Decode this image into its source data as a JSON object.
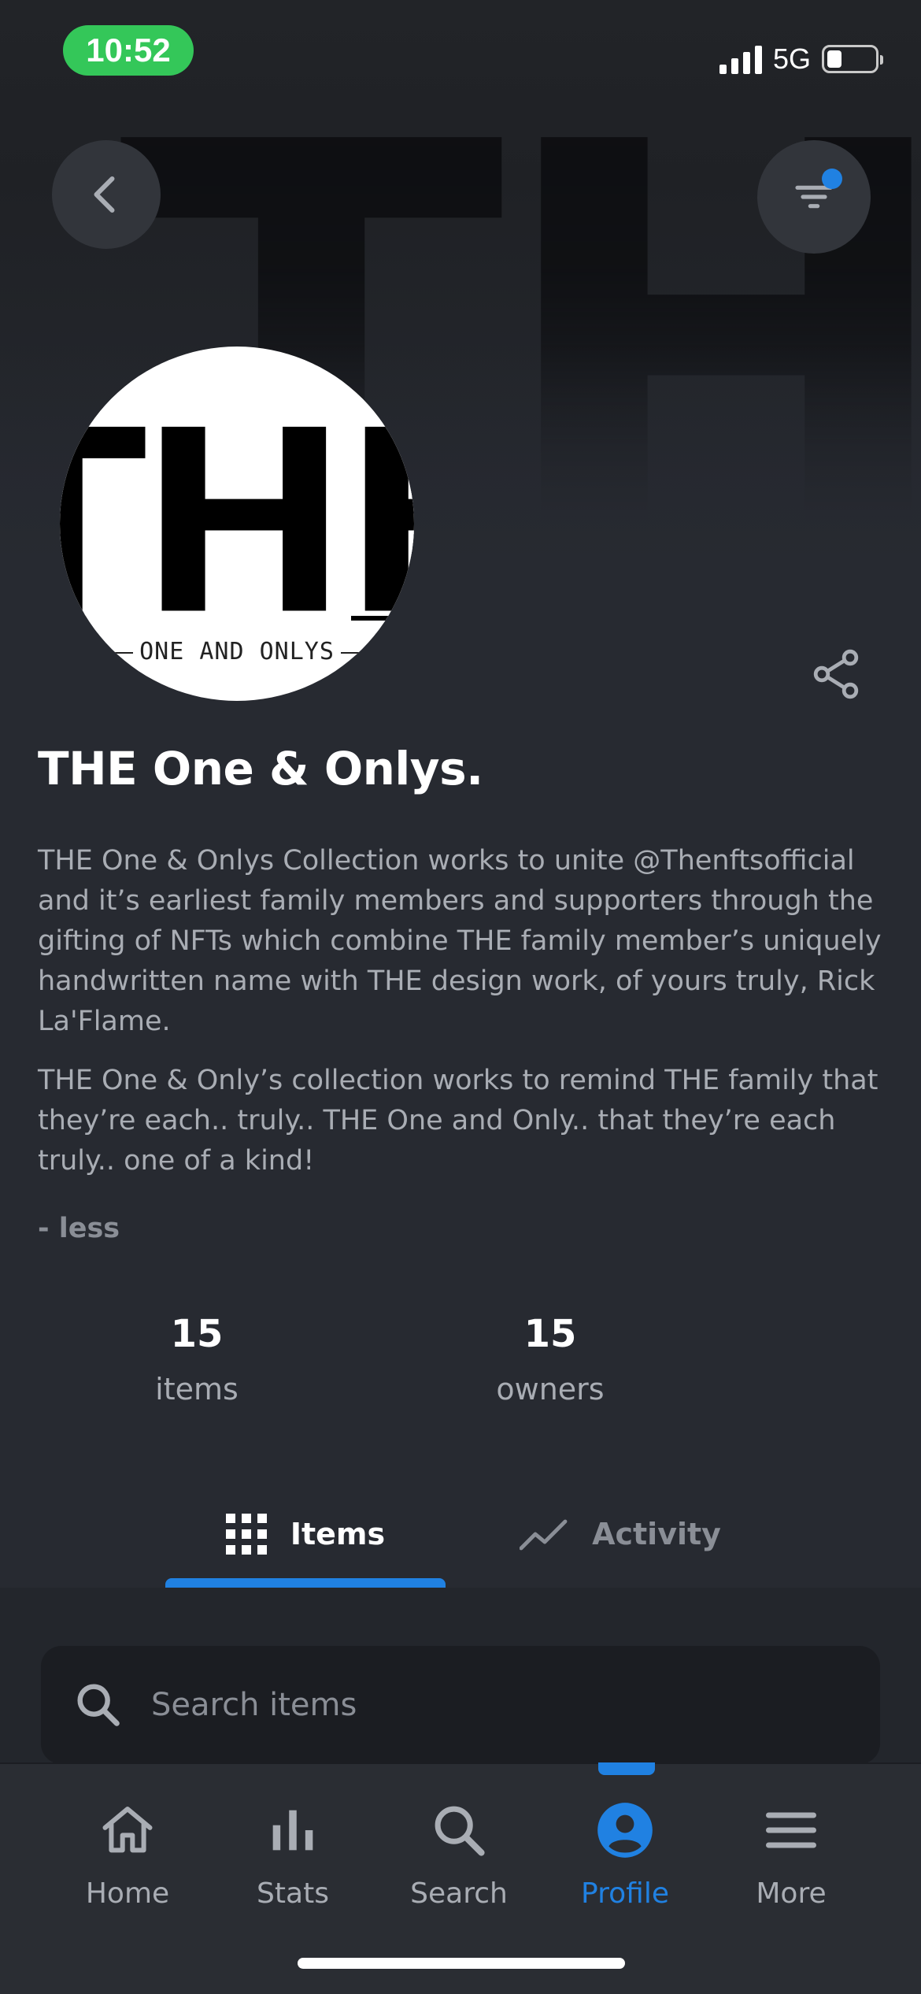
{
  "status_bar": {
    "time": "10:52",
    "network": "5G",
    "battery_level": 0.25
  },
  "header": {
    "banner_text": "THE",
    "back_icon": "chevron-left-icon",
    "filter_icon": "filter-icon",
    "accent_color": "#2081e2"
  },
  "collection": {
    "avatar_title": "THE",
    "avatar_subtitle": "ONE AND ONLYS",
    "name": "THE One & Onlys.",
    "description": [
      "THE One & Onlys Collection works to unite @Thenftsofficial and it’s earliest family members and supporters through the gifting of NFTs which combine THE family member’s uniquely handwritten name with THE design work, of yours truly, Rick La'Flame.",
      "THE One & Only’s collection works to remind THE family that they’re each.. truly.. THE One and Only.. that they’re each truly.. one of a kind!"
    ],
    "less_label": "- less"
  },
  "stats": {
    "items": {
      "value": "15",
      "label": "items"
    },
    "owners": {
      "value": "15",
      "label": "owners"
    }
  },
  "tabs": [
    {
      "label": "Items",
      "icon": "grid-icon",
      "active": true
    },
    {
      "label": "Activity",
      "icon": "activity-icon",
      "active": false
    }
  ],
  "search": {
    "placeholder": "Search items",
    "value": ""
  },
  "bottom_nav": [
    {
      "label": "Home",
      "icon": "home-icon",
      "active": false
    },
    {
      "label": "Stats",
      "icon": "stats-icon",
      "active": false
    },
    {
      "label": "Search",
      "icon": "search-icon",
      "active": false
    },
    {
      "label": "Profile",
      "icon": "profile-icon",
      "active": true
    },
    {
      "label": "More",
      "icon": "menu-icon",
      "active": false
    }
  ]
}
